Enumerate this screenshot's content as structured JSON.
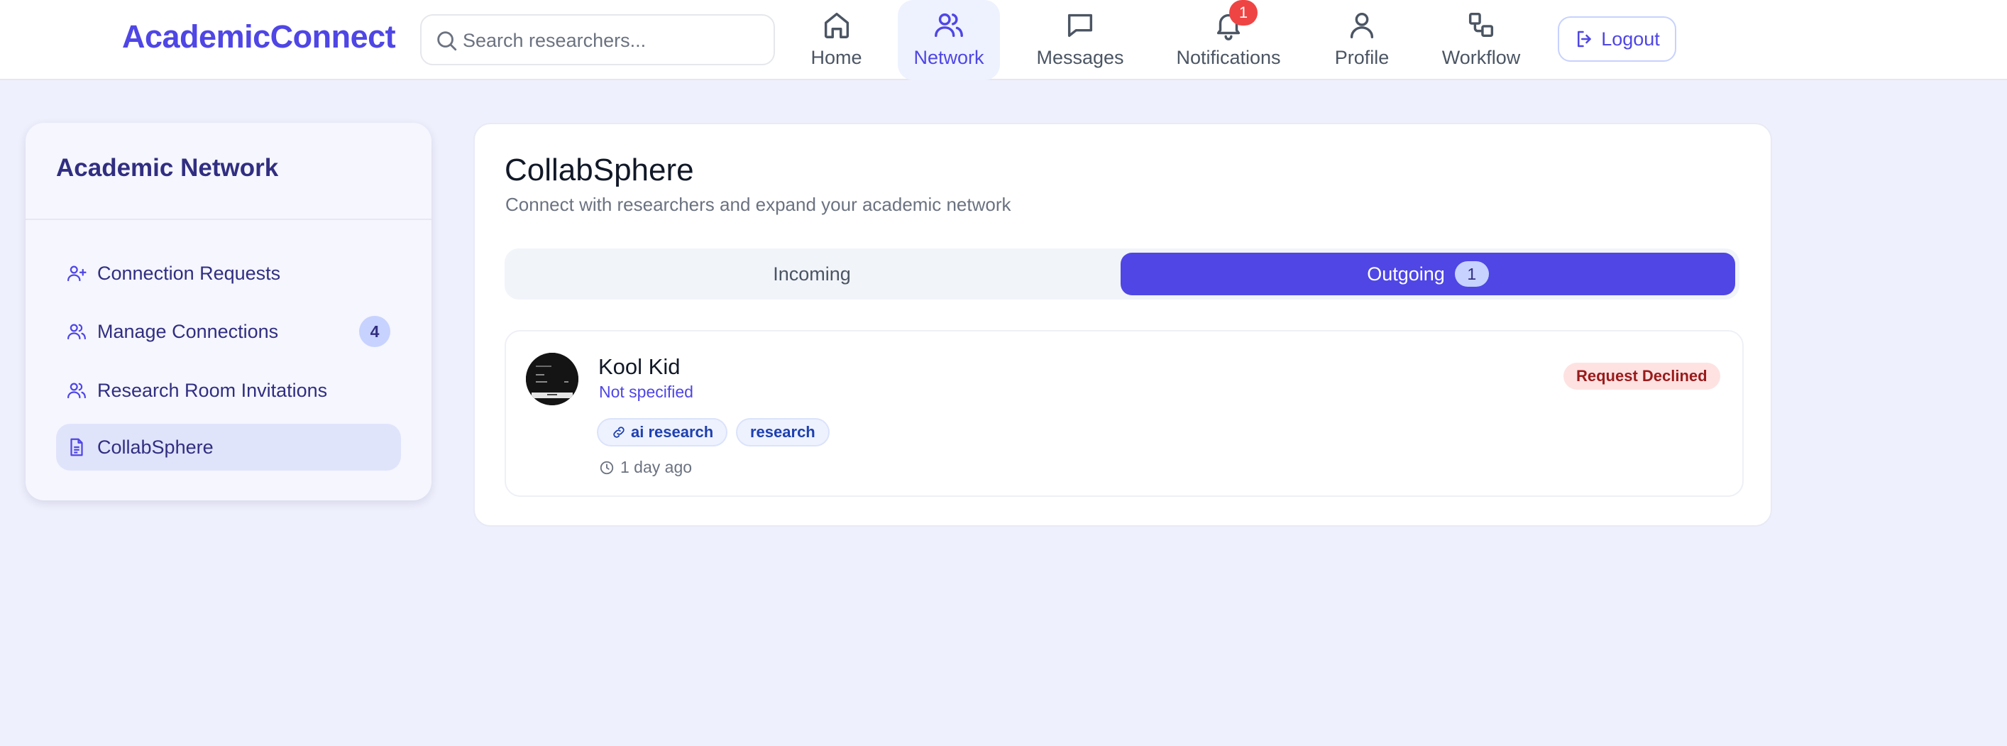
{
  "header": {
    "brand": "AcademicConnect",
    "search_placeholder": "Search researchers...",
    "nav": [
      {
        "label": "Home",
        "icon": "home-icon"
      },
      {
        "label": "Network",
        "icon": "users-icon",
        "active": true
      },
      {
        "label": "Messages",
        "icon": "message-icon"
      },
      {
        "label": "Notifications",
        "icon": "bell-icon",
        "badge": "1"
      },
      {
        "label": "Profile",
        "icon": "user-icon"
      },
      {
        "label": "Workflow",
        "icon": "workflow-icon"
      }
    ],
    "logout_label": "Logout"
  },
  "sidebar": {
    "title": "Academic Network",
    "items": [
      {
        "label": "Connection Requests",
        "icon": "user-plus-icon"
      },
      {
        "label": "Manage Connections",
        "icon": "users-icon",
        "count": "4"
      },
      {
        "label": "Research Room Invitations",
        "icon": "users-icon"
      },
      {
        "label": "CollabSphere",
        "icon": "document-icon",
        "active": true
      }
    ]
  },
  "main": {
    "title": "CollabSphere",
    "subtitle": "Connect with researchers and expand your academic network",
    "tabs": [
      {
        "label": "Incoming"
      },
      {
        "label": "Outgoing",
        "count": "1",
        "active": true
      }
    ],
    "requests": [
      {
        "name": "Kool Kid",
        "role": "Not specified",
        "tags": [
          "ai research",
          "research"
        ],
        "time": "1 day ago",
        "status": "Request Declined"
      }
    ]
  },
  "colors": {
    "accent": "#4f46e5",
    "page_bg": "#eff0fd",
    "declined_bg": "#fee2e2",
    "declined_text": "#991b1b",
    "notification_badge": "#ef4444"
  }
}
